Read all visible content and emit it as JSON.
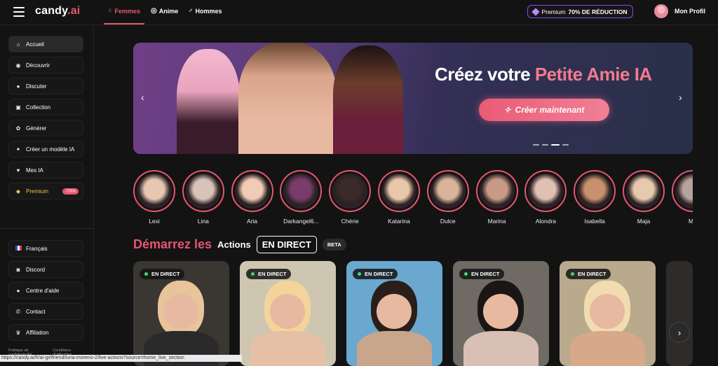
{
  "header": {
    "logo_main": "candy",
    "logo_ai": ".ai",
    "tabs": [
      {
        "label": "Femmes",
        "icon": "female-symbol-icon",
        "active": true
      },
      {
        "label": "Anime",
        "icon": "anime-icon",
        "active": false
      },
      {
        "label": "Hommes",
        "icon": "male-symbol-icon",
        "active": false
      }
    ],
    "premium_label": "Premium",
    "premium_discount": "70% DE RÉDUCTION",
    "profile_label": "Mon Profil"
  },
  "sidebar": {
    "items": [
      {
        "label": "Accueil",
        "icon": "home-icon"
      },
      {
        "label": "Découvrir",
        "icon": "compass-icon"
      },
      {
        "label": "Discuter",
        "icon": "chat-icon"
      },
      {
        "label": "Collection",
        "icon": "collection-icon"
      },
      {
        "label": "Générer",
        "icon": "generate-icon"
      },
      {
        "label": "Créer un modèle IA",
        "icon": "magic-wand-icon"
      },
      {
        "label": "Mes IA",
        "icon": "mask-icon"
      },
      {
        "label": "Premium",
        "icon": "diamond-icon",
        "badge": "-70%"
      }
    ],
    "bottom_items": [
      {
        "label": "Français",
        "icon": "flag-fr-icon"
      },
      {
        "label": "Discord",
        "icon": "discord-icon"
      },
      {
        "label": "Centre d'aide",
        "icon": "help-icon"
      },
      {
        "label": "Contact",
        "icon": "phone-icon"
      },
      {
        "label": "Affiliation",
        "icon": "trophy-icon"
      }
    ],
    "footer": {
      "privacy": "Politique de confidentialité",
      "terms": "Conditions d'utilisation"
    }
  },
  "banner": {
    "title_prefix": "Créez votre ",
    "title_highlight": "Petite Amie IA",
    "cta_label": "Créer maintenant",
    "prev": "‹",
    "next": "›"
  },
  "stories": [
    "Lexi",
    "Lina",
    "Aria",
    "Darkangel6...",
    "Chérie",
    "Katarina",
    "Dulce",
    "Marina",
    "Alondra",
    "Isabella",
    "Maja",
    "Mo"
  ],
  "live_section": {
    "title_pink": "Démarrez les",
    "title_white": "Actions",
    "title_boxed": "EN DIRECT",
    "beta": "BETA",
    "card_badge": "EN DIRECT",
    "card_count": 5,
    "next": "›"
  },
  "statusbar": {
    "url": "https://candy.ai/fr/ai-girlfriend/luna-moreno-2/live-actions?source=home_live_section"
  }
}
